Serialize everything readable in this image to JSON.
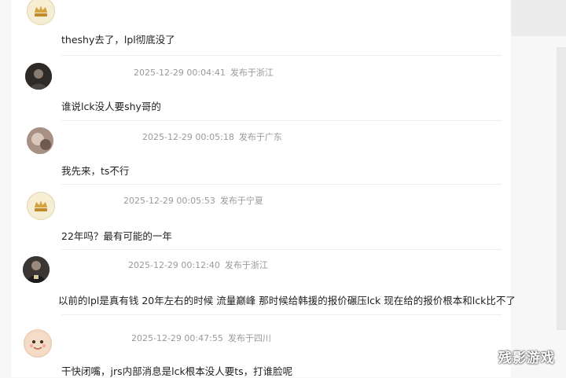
{
  "comments": [
    {
      "avatar": "crown-badge-avatar",
      "date": "",
      "location": "",
      "text": "theshy去了，lpl彻底没了"
    },
    {
      "avatar": "dark-portrait-avatar",
      "date": "2025-12-29 00:04:41",
      "location": "发布于浙江",
      "text": "谁说lck没人要shy哥的"
    },
    {
      "avatar": "photo-avatar",
      "date": "2025-12-29 00:05:18",
      "location": "发布于广东",
      "text": "我先来，ts不行"
    },
    {
      "avatar": "crown-badge-avatar",
      "date": "2025-12-29 00:05:53",
      "location": "发布于宁夏",
      "text": "22年吗？最有可能的一年"
    },
    {
      "avatar": "dark-shirt-avatar",
      "date": "2025-12-29 00:12:40",
      "location": "发布于浙江",
      "text": "以前的lpl是真有钱 20年左右的时候 流量巅峰 那时候给韩援的报价碾压lck 现在给的报价根本和lck比不了"
    },
    {
      "avatar": "cartoon-avatar",
      "date": "2025-12-29 00:47:55",
      "location": "发布于四川",
      "text": "干快闭嘴，jrs内部消息是lck根本没人要ts，打谁脸呢"
    }
  ],
  "watermark": "残影游戏"
}
